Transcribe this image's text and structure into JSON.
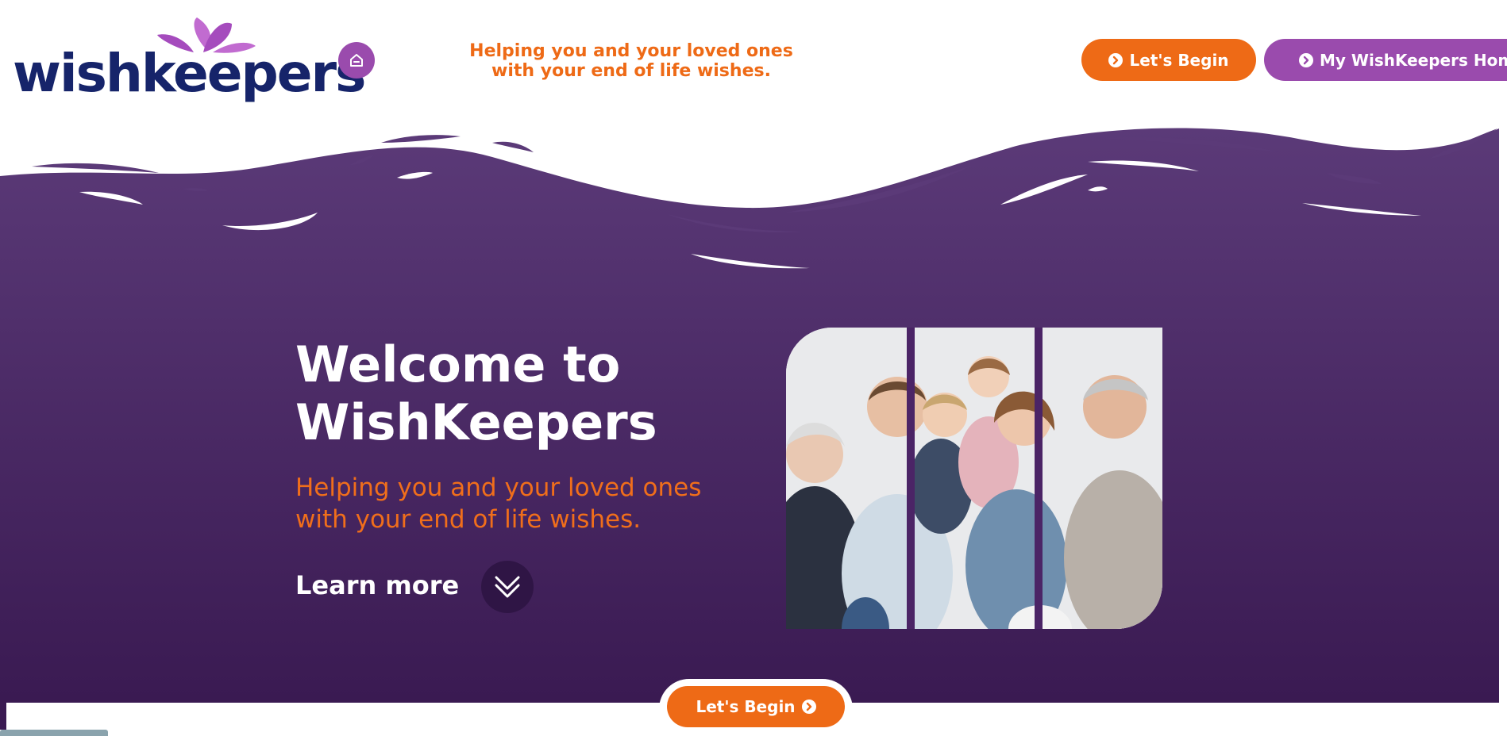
{
  "brand": {
    "logo_text": "wishkeepers",
    "logo_color": "#16246a",
    "petal_color": "#b45ac6"
  },
  "header": {
    "tagline_line1": "Helping you and your loved ones",
    "tagline_line2": "with your end of life wishes.",
    "home_icon": "home-icon",
    "begin_label": "Let's Begin",
    "my_home_label": "My WishKeepers Home"
  },
  "hero": {
    "title_line1": "Welcome to",
    "title_line2": "WishKeepers",
    "subtitle_line1": "Helping you and your loved ones",
    "subtitle_line2": "with your end of life wishes.",
    "learn_more": "Learn more",
    "learn_icon": "double-chevron-down-icon",
    "photo_alt": "family-photo"
  },
  "footer": {
    "begin_label": "Let's Begin"
  },
  "colors": {
    "orange": "#ee6a16",
    "purple": "#9a4bad",
    "hero_top": "#5b3a78",
    "hero_bottom": "#3a1a52"
  }
}
